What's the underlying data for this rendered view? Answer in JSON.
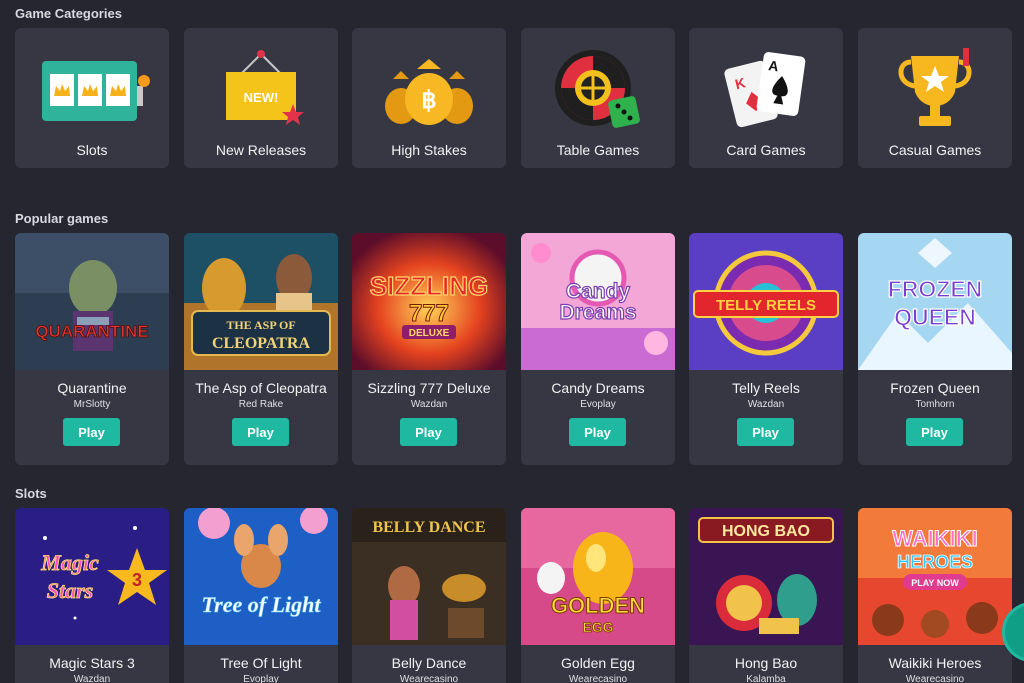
{
  "sections": {
    "categories_title": "Game Categories",
    "popular_title": "Popular games",
    "slots_title": "Slots"
  },
  "categories": [
    {
      "label": "Slots",
      "icon": "slot-machine-icon"
    },
    {
      "label": "New Releases",
      "icon": "new-sign-icon"
    },
    {
      "label": "High Stakes",
      "icon": "money-bags-icon"
    },
    {
      "label": "Table Games",
      "icon": "roulette-icon"
    },
    {
      "label": "Card Games",
      "icon": "playing-cards-icon"
    },
    {
      "label": "Casual Games",
      "icon": "trophy-icon"
    }
  ],
  "new_badge": "NEW!",
  "popular": [
    {
      "name": "Quarantine",
      "provider": "MrSlotty",
      "thumb_text": "QUARANTINE",
      "play": "Play"
    },
    {
      "name": "The Asp of Cleopatra",
      "provider": "Red Rake",
      "thumb_text": "THE ASP OF CLEOPATRA",
      "play": "Play"
    },
    {
      "name": "Sizzling 777 Deluxe",
      "provider": "Wazdan",
      "thumb_text": "SIZZLING 777 DELUXE",
      "play": "Play"
    },
    {
      "name": "Candy Dreams",
      "provider": "Evoplay",
      "thumb_text": "Candy Dreams",
      "play": "Play"
    },
    {
      "name": "Telly Reels",
      "provider": "Wazdan",
      "thumb_text": "TELLY REELS",
      "play": "Play"
    },
    {
      "name": "Frozen Queen",
      "provider": "Tomhorn",
      "thumb_text": "FROZEN QUEEN",
      "play": "Play"
    }
  ],
  "slots": [
    {
      "name": "Magic Stars 3",
      "provider": "Wazdan",
      "thumb_text": "Magic Stars 3"
    },
    {
      "name": "Tree Of Light",
      "provider": "Evoplay",
      "thumb_text": "Tree of Light"
    },
    {
      "name": "Belly Dance",
      "provider": "Wearecasino",
      "thumb_text": "BELLY DANCE"
    },
    {
      "name": "Golden Egg",
      "provider": "Wearecasino",
      "thumb_text": "GOLDEN EGG"
    },
    {
      "name": "Hong Bao",
      "provider": "Kalamba",
      "thumb_text": "HONG BAO"
    },
    {
      "name": "Waikiki Heroes",
      "provider": "Wearecasino",
      "thumb_text": "WAIKIKI HEROES"
    }
  ],
  "waikiki_play_now": "PLAY NOW",
  "colors": {
    "background": "#25262f",
    "card": "#363742",
    "accent": "#1fb9a2"
  }
}
